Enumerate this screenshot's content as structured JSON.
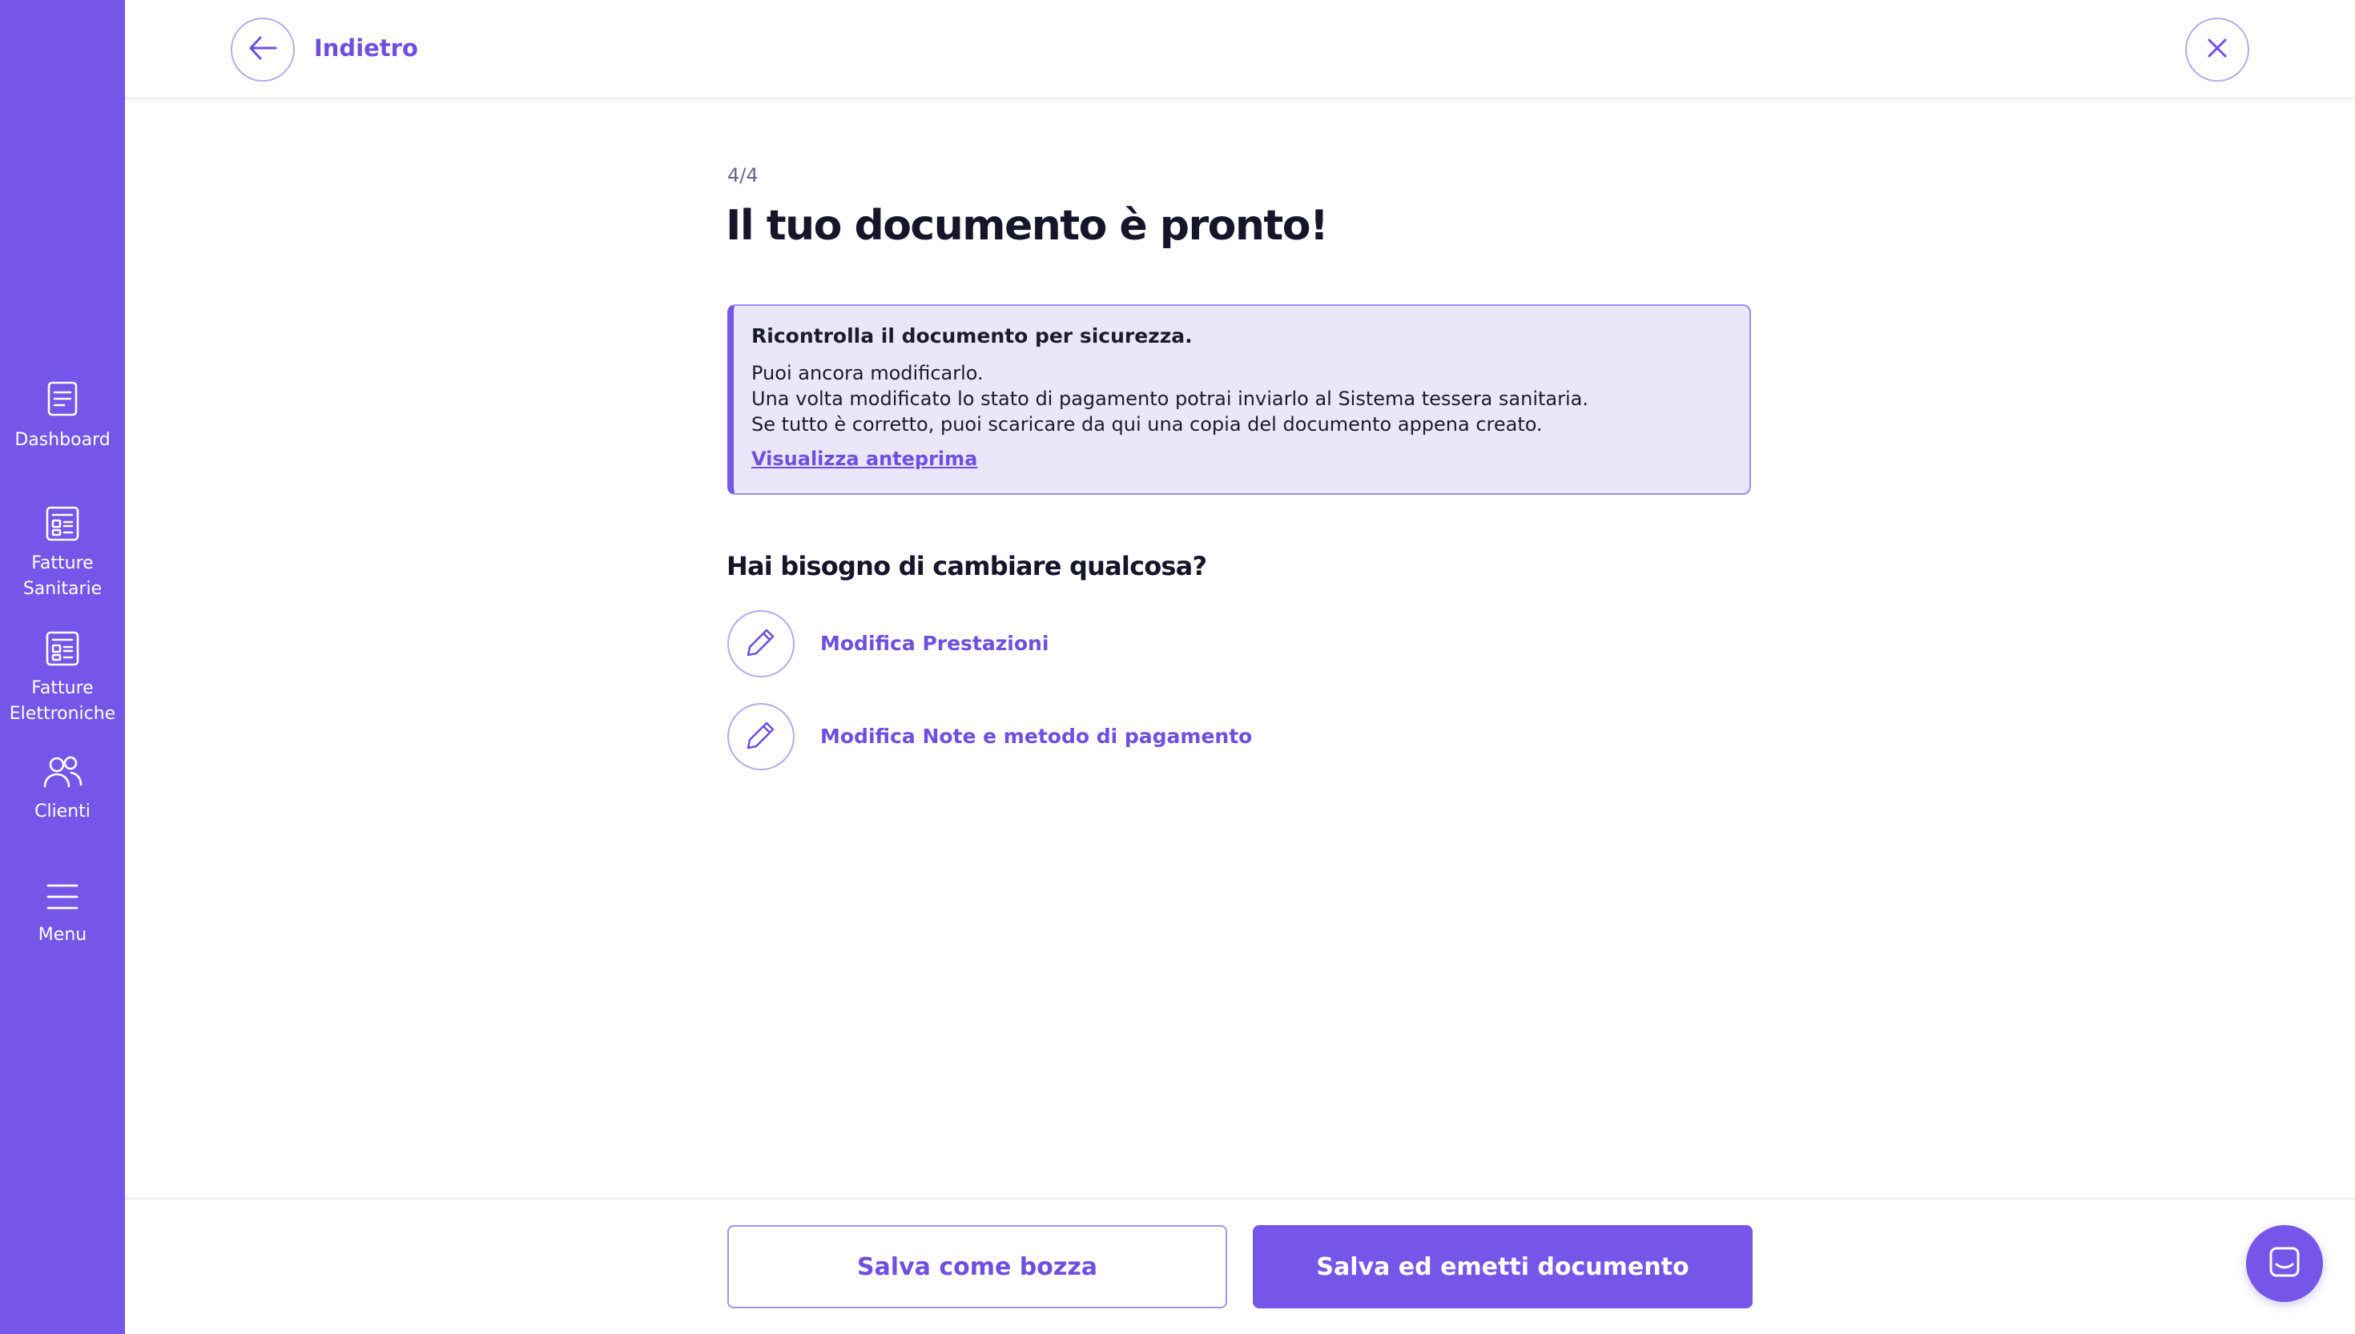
{
  "sidebar": {
    "items": [
      {
        "label": "Dashboard",
        "icon": "dashboard-icon"
      },
      {
        "label": "Fatture\nSanitarie",
        "icon": "invoice-icon"
      },
      {
        "label": "Fatture\nElettroniche",
        "icon": "invoice-icon"
      },
      {
        "label": "Clienti",
        "icon": "users-icon"
      },
      {
        "label": "Menu",
        "icon": "hamburger-icon"
      }
    ]
  },
  "header": {
    "back_label": "Indietro"
  },
  "main": {
    "step": "4/4",
    "title": "Il tuo documento è pronto!",
    "info": {
      "title": "Ricontrolla il documento per sicurezza.",
      "line1": "Puoi ancora modificarlo.",
      "line2": "Una volta modificato lo stato di pagamento potrai inviarlo al Sistema tessera sanitaria.",
      "line3": "Se tutto è corretto, puoi scaricare da qui una copia del documento appena creato.",
      "link": "Visualizza anteprima"
    },
    "subtitle": "Hai bisogno di cambiare qualcosa?",
    "edits": [
      {
        "label": "Modifica Prestazioni"
      },
      {
        "label": "Modifica Note e metodo di pagamento"
      }
    ]
  },
  "footer": {
    "draft_label": "Salva come bozza",
    "emit_label": "Salva ed emetti documento"
  },
  "colors": {
    "accent": "#7656e8",
    "info_bg": "#ebe7fb",
    "text": "#16162b"
  }
}
